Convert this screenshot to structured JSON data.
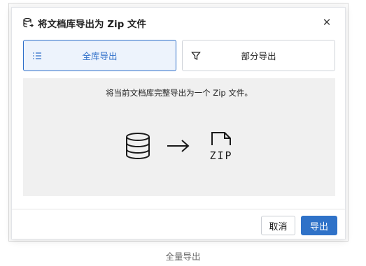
{
  "dialog": {
    "title": "将文档库导出为 Zip 文件",
    "title_icon": "database-export-icon",
    "close_icon": "close-icon"
  },
  "modes": [
    {
      "label": "全库导出",
      "icon": "list-icon",
      "selected": true
    },
    {
      "label": "部分导出",
      "icon": "filter-icon",
      "selected": false
    }
  ],
  "panel": {
    "description": "将当前文档库完整导出为一个 Zip 文件。",
    "illustration": [
      "database-icon",
      "arrow-right-icon",
      "zip-file-icon"
    ],
    "zip_label": "ZIP"
  },
  "footer": {
    "cancel_label": "取消",
    "export_label": "导出"
  },
  "caption": "全量导出",
  "colors": {
    "accent": "#2f72c8",
    "selected_tab_bg": "#edf3fc",
    "panel_bg": "#f0f0f0"
  }
}
